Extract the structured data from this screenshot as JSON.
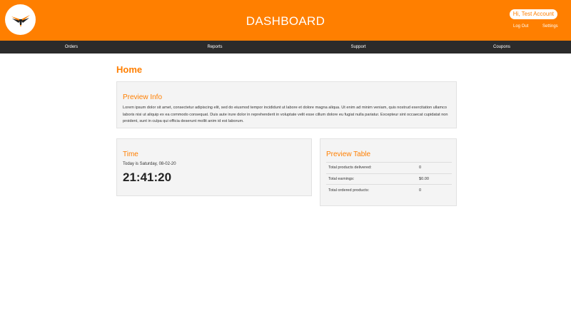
{
  "header": {
    "title": "DASHBOARD",
    "greeting": "Hi, Test Account",
    "logout_label": "Log Out",
    "settings_label": "Settings",
    "logo_icon": "bird-wings-icon",
    "brand_color": "#ff7f00"
  },
  "nav": {
    "items": [
      {
        "label": "Orders"
      },
      {
        "label": "Reports"
      },
      {
        "label": "Support"
      },
      {
        "label": "Coupons"
      }
    ]
  },
  "main": {
    "heading": "Home",
    "preview_info": {
      "title": "Preview Info",
      "text": "Lorem ipsum dolor sit amet, consectetur adipiscing elit, sed do eiusmod tempor incididunt ut labore et dolore magna aliqua. Ut enim ad minim veniam, quis nostrud exercitation ullamco laboris nisi ut aliquip ex ea commodo consequat. Duis aute irure dolor in reprehenderit in voluptate velit esse cillum dolore eu fugiat nulla pariatur. Excepteur sint occaecat cupidatat non proident, sunt in culpa qui officia deserunt mollit anim id est laborum."
    },
    "time": {
      "title": "Time",
      "date_text": "Today is Saturday, 08-02-20",
      "clock": "21:41:20"
    },
    "preview_table": {
      "title": "Preview Table",
      "rows": [
        {
          "label": "Total products delivered:",
          "value": "0"
        },
        {
          "label": "Total earnings:",
          "value": "$0.00"
        },
        {
          "label": "Total ordered products:",
          "value": "0"
        }
      ]
    }
  }
}
